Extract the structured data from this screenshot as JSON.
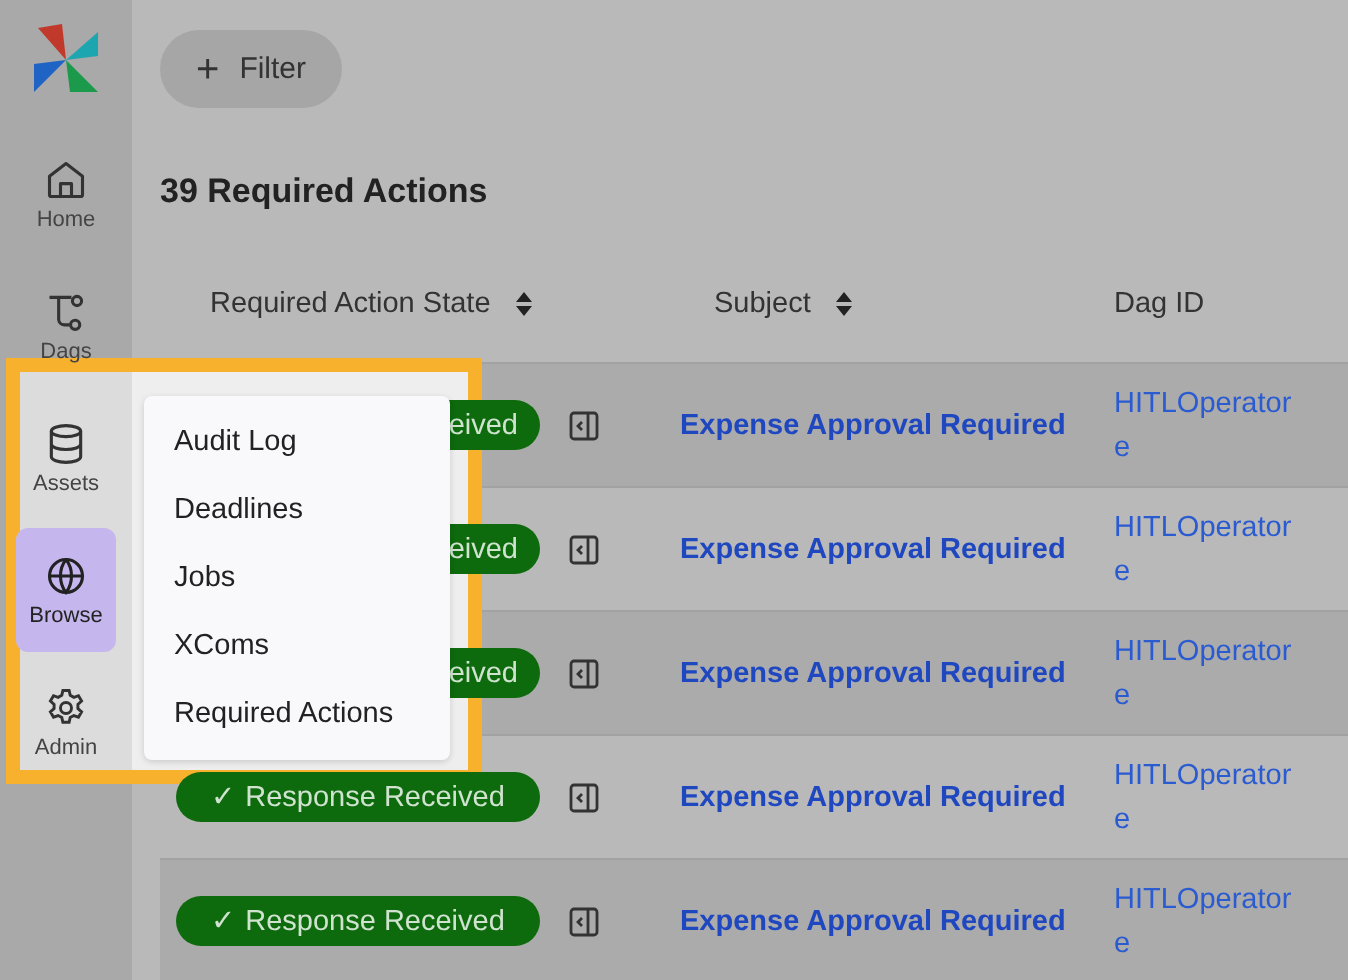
{
  "sidebar": {
    "items": [
      {
        "label": "Home",
        "selected": false
      },
      {
        "label": "Dags",
        "selected": false
      },
      {
        "label": "Assets",
        "selected": false
      },
      {
        "label": "Browse",
        "selected": true
      },
      {
        "label": "Admin",
        "selected": false
      }
    ]
  },
  "filter_button": {
    "icon": "+",
    "label": "Filter"
  },
  "title": "39 Required Actions",
  "table": {
    "columns": [
      {
        "label": "Required Action State",
        "sortable": true
      },
      {
        "label": "Subject",
        "sortable": true
      },
      {
        "label": "Dag ID",
        "sortable": false
      }
    ],
    "rows": [
      {
        "state": "eived",
        "subject": "Expense Approval Required",
        "dag_id": [
          "HITLOperator",
          "e"
        ]
      },
      {
        "state": "eived",
        "subject": "Expense Approval Required",
        "dag_id": [
          "HITLOperator",
          "e"
        ]
      },
      {
        "state": "eived",
        "subject": "Expense Approval Required",
        "dag_id": [
          "HITLOperator",
          "e"
        ]
      },
      {
        "state": "✓ Response Received",
        "subject": "Expense Approval Required",
        "dag_id": [
          "HITLOperator",
          "e"
        ]
      },
      {
        "state": "✓ Response Received",
        "subject": "Expense Approval Required",
        "dag_id": [
          "HITLOperator",
          "e"
        ]
      }
    ]
  },
  "browse_menu": {
    "items": [
      "Audit Log",
      "Deadlines",
      "Jobs",
      "XComs",
      "Required Actions"
    ]
  }
}
